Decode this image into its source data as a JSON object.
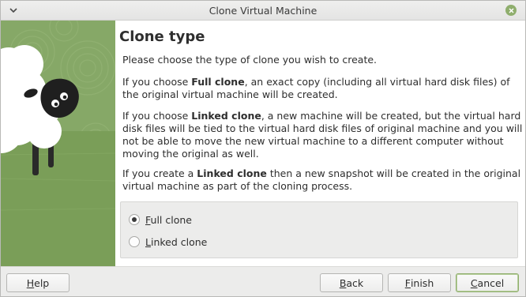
{
  "window": {
    "title": "Clone Virtual Machine",
    "accent_color": "#8fae6d"
  },
  "page": {
    "heading": "Clone type",
    "intro": "Please choose the type of clone you wish to create.",
    "full_clone_para": {
      "before": "If you choose ",
      "bold": "Full clone",
      "after": ", an exact copy (including all virtual hard disk files) of the original virtual machine will be created."
    },
    "linked_clone_para": {
      "before": "If you choose ",
      "bold": "Linked clone",
      "after": ", a new machine will be created, but the virtual hard disk files will be tied to the virtual hard disk files of original machine and you will not be able to move the new virtual machine to a different computer without moving the original as well."
    },
    "snapshot_para": {
      "before": "If you create a ",
      "bold": "Linked clone",
      "after": " then a new snapshot will be created in the original virtual machine as part of the cloning process."
    }
  },
  "options": [
    {
      "mnemonic": "F",
      "rest": "ull clone",
      "selected": true
    },
    {
      "mnemonic": "L",
      "rest": "inked clone",
      "selected": false
    }
  ],
  "buttons": {
    "help": {
      "mnemonic": "H",
      "rest": "elp"
    },
    "back": {
      "mnemonic": "B",
      "rest": "ack"
    },
    "finish": {
      "mnemonic": "F",
      "rest": "inish"
    },
    "cancel": {
      "mnemonic": "C",
      "rest": "ancel"
    }
  },
  "icons": {
    "menu": "chevron-down-icon",
    "close": "close-icon",
    "selected_radio": "radio-selected",
    "unselected_radio": "radio-unselected"
  }
}
